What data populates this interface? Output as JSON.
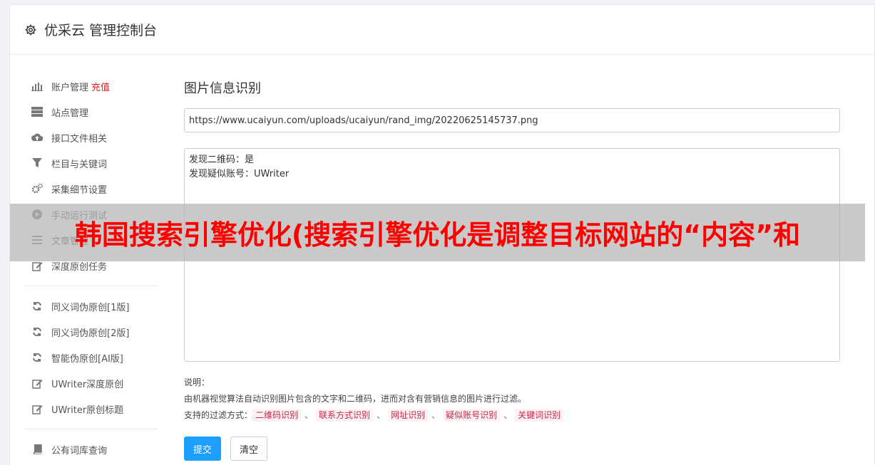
{
  "app": {
    "title": "优采云 管理控制台"
  },
  "sidebar": {
    "groups": [
      [
        {
          "label": "账户管理",
          "badge": "充值",
          "icon": "bar-chart-icon"
        },
        {
          "label": "站点管理",
          "icon": "server-icon"
        },
        {
          "label": "接口文件相关",
          "icon": "cloud-upload-icon"
        },
        {
          "label": "栏目与关键词",
          "icon": "filter-icon"
        },
        {
          "label": "采集细节设置",
          "icon": "gears-icon"
        },
        {
          "label": "手动运行测试",
          "icon": "play-circle-icon"
        },
        {
          "label": "文章管理",
          "icon": "list-icon"
        },
        {
          "label": "深度原创任务",
          "icon": "edit-icon"
        }
      ],
      [
        {
          "label": "同义词伪原创[1版]",
          "icon": "refresh-icon"
        },
        {
          "label": "同义词伪原创[2版]",
          "icon": "refresh-icon"
        },
        {
          "label": "智能伪原创[AI版]",
          "icon": "refresh-icon"
        },
        {
          "label": "UWriter深度原创",
          "icon": "edit-icon"
        },
        {
          "label": "UWriter原创标题",
          "icon": "edit-icon"
        }
      ],
      [
        {
          "label": "公有词库查询",
          "icon": "book-icon"
        }
      ]
    ]
  },
  "main": {
    "title": "图片信息识别",
    "url_value": "https://www.ucaiyun.com/uploads/ucaiyun/rand_img/20220625145737.png",
    "result_text": "发现二维码：是\n发现疑似账号：UWriter",
    "help": {
      "heading": "说明：",
      "description": "由机器视觉算法自动识别图片包含的文字和二维码，进而对含有营销信息的图片进行过滤。",
      "filter_label": "支持的过滤方式：",
      "filters": [
        "二维码识别",
        "联系方式识别",
        "网址识别",
        "疑似账号识别",
        "关键词识别"
      ],
      "separator": "、"
    },
    "buttons": {
      "submit": "提交",
      "clear": "清空"
    }
  },
  "banner": {
    "text": "韩国搜索引擎优化(搜索引擎优化是调整目标网站的“内容”和"
  },
  "colors": {
    "accent": "#1e9fff",
    "badge": "#e02020",
    "banner_text": "#ff0000"
  }
}
